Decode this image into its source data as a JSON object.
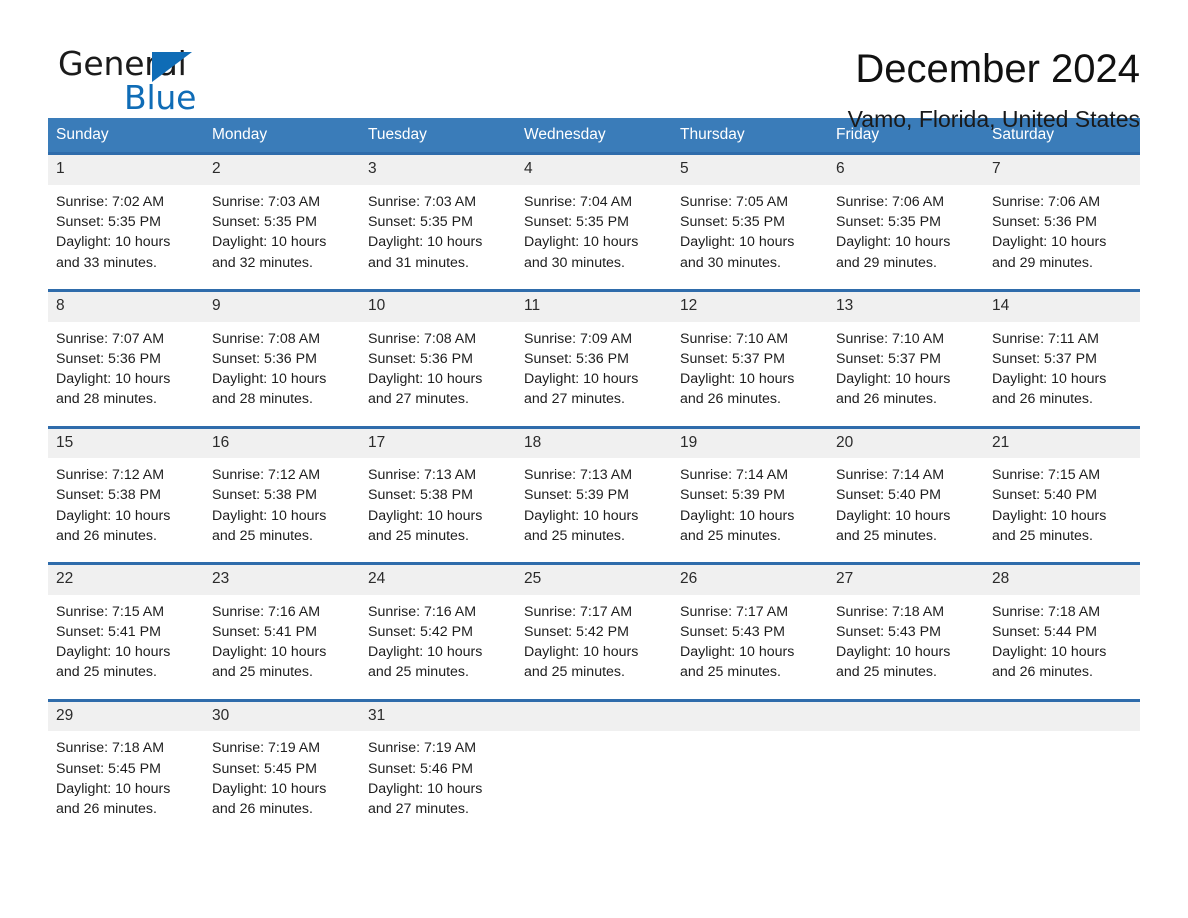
{
  "brand": {
    "name_general": "General",
    "name_blue": "Blue"
  },
  "header": {
    "month_title": "December 2024",
    "location": "Vamo, Florida, United States"
  },
  "theme": {
    "header_blue": "#3a7cb9",
    "row_border_blue": "#2f6cab",
    "daynum_band": "#f0f0f0",
    "logo_blue": "#0f6cb6"
  },
  "calendar": {
    "day_headers": [
      "Sunday",
      "Monday",
      "Tuesday",
      "Wednesday",
      "Thursday",
      "Friday",
      "Saturday"
    ],
    "weeks": [
      [
        {
          "day": "1",
          "sunrise": "Sunrise: 7:02 AM",
          "sunset": "Sunset: 5:35 PM",
          "daylight": "Daylight: 10 hours and 33 minutes."
        },
        {
          "day": "2",
          "sunrise": "Sunrise: 7:03 AM",
          "sunset": "Sunset: 5:35 PM",
          "daylight": "Daylight: 10 hours and 32 minutes."
        },
        {
          "day": "3",
          "sunrise": "Sunrise: 7:03 AM",
          "sunset": "Sunset: 5:35 PM",
          "daylight": "Daylight: 10 hours and 31 minutes."
        },
        {
          "day": "4",
          "sunrise": "Sunrise: 7:04 AM",
          "sunset": "Sunset: 5:35 PM",
          "daylight": "Daylight: 10 hours and 30 minutes."
        },
        {
          "day": "5",
          "sunrise": "Sunrise: 7:05 AM",
          "sunset": "Sunset: 5:35 PM",
          "daylight": "Daylight: 10 hours and 30 minutes."
        },
        {
          "day": "6",
          "sunrise": "Sunrise: 7:06 AM",
          "sunset": "Sunset: 5:35 PM",
          "daylight": "Daylight: 10 hours and 29 minutes."
        },
        {
          "day": "7",
          "sunrise": "Sunrise: 7:06 AM",
          "sunset": "Sunset: 5:36 PM",
          "daylight": "Daylight: 10 hours and 29 minutes."
        }
      ],
      [
        {
          "day": "8",
          "sunrise": "Sunrise: 7:07 AM",
          "sunset": "Sunset: 5:36 PM",
          "daylight": "Daylight: 10 hours and 28 minutes."
        },
        {
          "day": "9",
          "sunrise": "Sunrise: 7:08 AM",
          "sunset": "Sunset: 5:36 PM",
          "daylight": "Daylight: 10 hours and 28 minutes."
        },
        {
          "day": "10",
          "sunrise": "Sunrise: 7:08 AM",
          "sunset": "Sunset: 5:36 PM",
          "daylight": "Daylight: 10 hours and 27 minutes."
        },
        {
          "day": "11",
          "sunrise": "Sunrise: 7:09 AM",
          "sunset": "Sunset: 5:36 PM",
          "daylight": "Daylight: 10 hours and 27 minutes."
        },
        {
          "day": "12",
          "sunrise": "Sunrise: 7:10 AM",
          "sunset": "Sunset: 5:37 PM",
          "daylight": "Daylight: 10 hours and 26 minutes."
        },
        {
          "day": "13",
          "sunrise": "Sunrise: 7:10 AM",
          "sunset": "Sunset: 5:37 PM",
          "daylight": "Daylight: 10 hours and 26 minutes."
        },
        {
          "day": "14",
          "sunrise": "Sunrise: 7:11 AM",
          "sunset": "Sunset: 5:37 PM",
          "daylight": "Daylight: 10 hours and 26 minutes."
        }
      ],
      [
        {
          "day": "15",
          "sunrise": "Sunrise: 7:12 AM",
          "sunset": "Sunset: 5:38 PM",
          "daylight": "Daylight: 10 hours and 26 minutes."
        },
        {
          "day": "16",
          "sunrise": "Sunrise: 7:12 AM",
          "sunset": "Sunset: 5:38 PM",
          "daylight": "Daylight: 10 hours and 25 minutes."
        },
        {
          "day": "17",
          "sunrise": "Sunrise: 7:13 AM",
          "sunset": "Sunset: 5:38 PM",
          "daylight": "Daylight: 10 hours and 25 minutes."
        },
        {
          "day": "18",
          "sunrise": "Sunrise: 7:13 AM",
          "sunset": "Sunset: 5:39 PM",
          "daylight": "Daylight: 10 hours and 25 minutes."
        },
        {
          "day": "19",
          "sunrise": "Sunrise: 7:14 AM",
          "sunset": "Sunset: 5:39 PM",
          "daylight": "Daylight: 10 hours and 25 minutes."
        },
        {
          "day": "20",
          "sunrise": "Sunrise: 7:14 AM",
          "sunset": "Sunset: 5:40 PM",
          "daylight": "Daylight: 10 hours and 25 minutes."
        },
        {
          "day": "21",
          "sunrise": "Sunrise: 7:15 AM",
          "sunset": "Sunset: 5:40 PM",
          "daylight": "Daylight: 10 hours and 25 minutes."
        }
      ],
      [
        {
          "day": "22",
          "sunrise": "Sunrise: 7:15 AM",
          "sunset": "Sunset: 5:41 PM",
          "daylight": "Daylight: 10 hours and 25 minutes."
        },
        {
          "day": "23",
          "sunrise": "Sunrise: 7:16 AM",
          "sunset": "Sunset: 5:41 PM",
          "daylight": "Daylight: 10 hours and 25 minutes."
        },
        {
          "day": "24",
          "sunrise": "Sunrise: 7:16 AM",
          "sunset": "Sunset: 5:42 PM",
          "daylight": "Daylight: 10 hours and 25 minutes."
        },
        {
          "day": "25",
          "sunrise": "Sunrise: 7:17 AM",
          "sunset": "Sunset: 5:42 PM",
          "daylight": "Daylight: 10 hours and 25 minutes."
        },
        {
          "day": "26",
          "sunrise": "Sunrise: 7:17 AM",
          "sunset": "Sunset: 5:43 PM",
          "daylight": "Daylight: 10 hours and 25 minutes."
        },
        {
          "day": "27",
          "sunrise": "Sunrise: 7:18 AM",
          "sunset": "Sunset: 5:43 PM",
          "daylight": "Daylight: 10 hours and 25 minutes."
        },
        {
          "day": "28",
          "sunrise": "Sunrise: 7:18 AM",
          "sunset": "Sunset: 5:44 PM",
          "daylight": "Daylight: 10 hours and 26 minutes."
        }
      ],
      [
        {
          "day": "29",
          "sunrise": "Sunrise: 7:18 AM",
          "sunset": "Sunset: 5:45 PM",
          "daylight": "Daylight: 10 hours and 26 minutes."
        },
        {
          "day": "30",
          "sunrise": "Sunrise: 7:19 AM",
          "sunset": "Sunset: 5:45 PM",
          "daylight": "Daylight: 10 hours and 26 minutes."
        },
        {
          "day": "31",
          "sunrise": "Sunrise: 7:19 AM",
          "sunset": "Sunset: 5:46 PM",
          "daylight": "Daylight: 10 hours and 27 minutes."
        },
        {
          "day": "",
          "sunrise": "",
          "sunset": "",
          "daylight": ""
        },
        {
          "day": "",
          "sunrise": "",
          "sunset": "",
          "daylight": ""
        },
        {
          "day": "",
          "sunrise": "",
          "sunset": "",
          "daylight": ""
        },
        {
          "day": "",
          "sunrise": "",
          "sunset": "",
          "daylight": ""
        }
      ]
    ]
  }
}
